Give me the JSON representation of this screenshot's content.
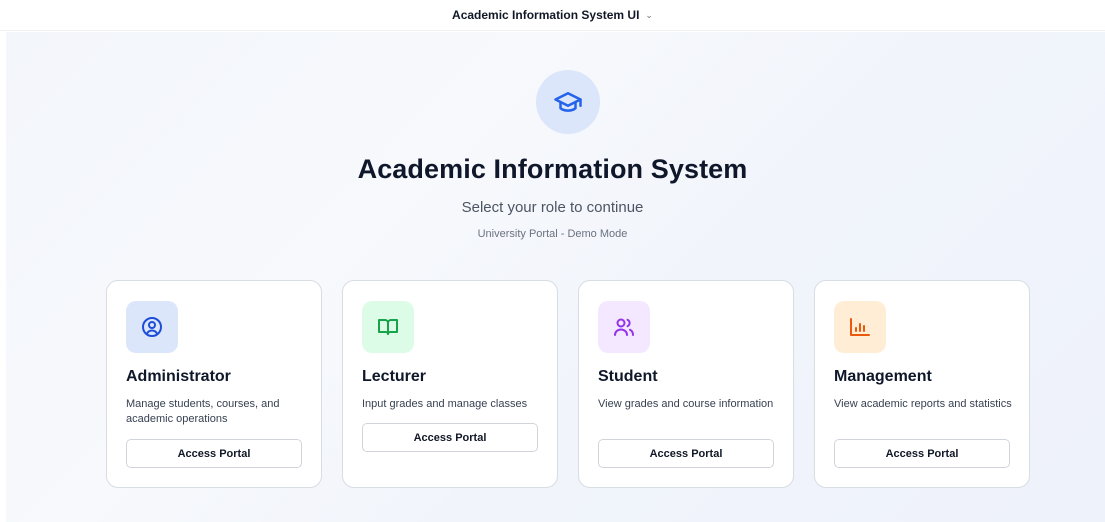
{
  "header": {
    "title": "Academic Information System UI",
    "dropdown_icon": "chevron-down-icon"
  },
  "hero": {
    "icon": "graduation-cap-icon",
    "icon_color": "#2563eb",
    "icon_bg": "#dbe6fb",
    "title": "Academic Information System",
    "subtitle": "Select your role to continue",
    "caption": "University Portal - Demo Mode"
  },
  "roles": [
    {
      "title": "Administrator",
      "description": "Manage students, courses, and academic operations",
      "button_label": "Access Portal",
      "icon": "user-circle-icon",
      "icon_color": "#1d4ed8",
      "icon_bg": "#dbe6fb"
    },
    {
      "title": "Lecturer",
      "description": "Input grades and manage classes",
      "button_label": "Access Portal",
      "icon": "book-open-icon",
      "icon_color": "#16a34a",
      "icon_bg": "#dcfce7"
    },
    {
      "title": "Student",
      "description": "View grades and course information",
      "button_label": "Access Portal",
      "icon": "users-icon",
      "icon_color": "#9333ea",
      "icon_bg": "#f3e8ff"
    },
    {
      "title": "Management",
      "description": "View academic reports and statistics",
      "button_label": "Access Portal",
      "icon": "bar-chart-icon",
      "icon_color": "#ea580c",
      "icon_bg": "#ffedd5"
    }
  ]
}
